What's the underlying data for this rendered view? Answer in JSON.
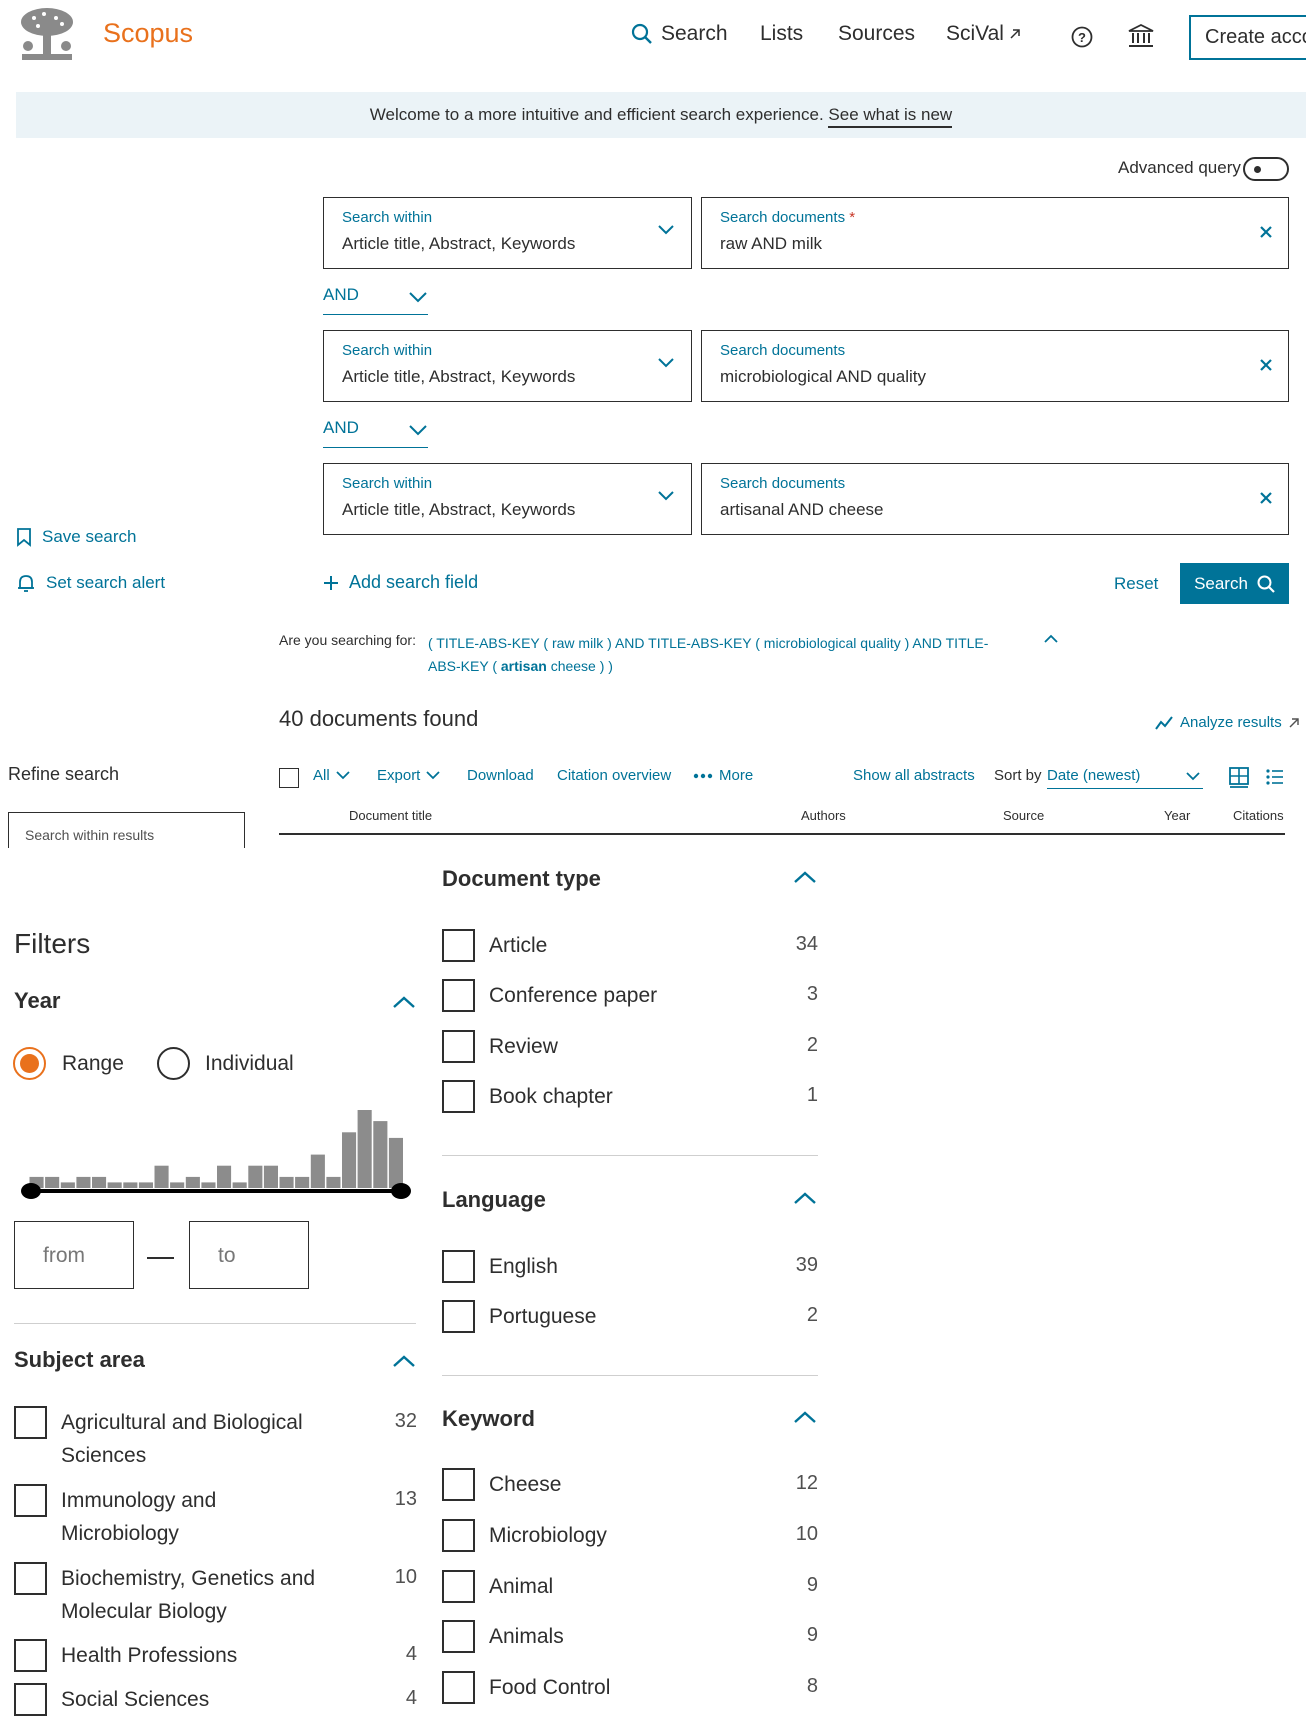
{
  "header": {
    "brand": "Scopus",
    "nav": [
      "Search",
      "Lists",
      "Sources",
      "SciVal",
      "Create acco"
    ]
  },
  "banner": {
    "text": "Welcome to a more intuitive and efficient search experience.",
    "link": "See what is new"
  },
  "advanced_query_label": "Advanced query",
  "search_rows": [
    {
      "within_label": "Search within",
      "within_value": "Article title, Abstract, Keywords",
      "doc_label": "Search documents",
      "doc_value": "raw AND milk",
      "required": "*"
    },
    {
      "within_label": "Search within",
      "within_value": "Article title, Abstract, Keywords",
      "doc_label": "Search documents",
      "doc_value": "microbiological AND quality"
    },
    {
      "within_label": "Search within",
      "within_value": "Article title, Abstract, Keywords",
      "doc_label": "Search documents",
      "doc_value": "artisanal AND cheese"
    }
  ],
  "operators": [
    "AND",
    "AND"
  ],
  "sidebar_links": {
    "save": "Save search",
    "alert": "Set search alert"
  },
  "actions": {
    "add_field": "Add search field",
    "reset": "Reset",
    "search": "Search"
  },
  "suggestion": {
    "label": "Are you searching for:",
    "part1": "( TITLE-ABS-KEY ( raw milk ) AND TITLE-ABS-KEY ( microbiological quality ) AND TITLE-ABS-KEY (",
    "bold": "artisan",
    "part2": "cheese ) )"
  },
  "results": {
    "found": "40 documents found",
    "analyze": "Analyze results"
  },
  "refine": {
    "title": "Refine search",
    "placeholder": "Search within results"
  },
  "toolbar": {
    "all": "All",
    "export": "Export",
    "download": "Download",
    "citation": "Citation overview",
    "more": "More",
    "show_abstracts": "Show all abstracts",
    "sort_by": "Sort by",
    "sort_value": "Date (newest)"
  },
  "columns": [
    "Document title",
    "Authors",
    "Source",
    "Year",
    "Citations"
  ],
  "filters": {
    "title": "Filters",
    "year": {
      "title": "Year",
      "range": "Range",
      "individual": "Individual",
      "from": "from",
      "to": "to",
      "mode": "Range"
    },
    "subject_area": {
      "title": "Subject area",
      "items": [
        {
          "label": "Agricultural and Biological Sciences",
          "count": "32"
        },
        {
          "label": "Immunology and Microbiology",
          "count": "13"
        },
        {
          "label": "Biochemistry, Genetics and Molecular Biology",
          "count": "10"
        },
        {
          "label": "Health Professions",
          "count": "4"
        },
        {
          "label": "Social Sciences",
          "count": "4"
        }
      ]
    },
    "document_type": {
      "title": "Document type",
      "items": [
        {
          "label": "Article",
          "count": "34"
        },
        {
          "label": "Conference paper",
          "count": "3"
        },
        {
          "label": "Review",
          "count": "2"
        },
        {
          "label": "Book chapter",
          "count": "1"
        }
      ]
    },
    "language": {
      "title": "Language",
      "items": [
        {
          "label": "English",
          "count": "39"
        },
        {
          "label": "Portuguese",
          "count": "2"
        }
      ]
    },
    "keyword": {
      "title": "Keyword",
      "items": [
        {
          "label": "Cheese",
          "count": "12"
        },
        {
          "label": "Microbiology",
          "count": "10"
        },
        {
          "label": "Animal",
          "count": "9"
        },
        {
          "label": "Animals",
          "count": "9"
        },
        {
          "label": "Food Control",
          "count": "8"
        }
      ]
    }
  },
  "year_histogram": [
    1,
    1,
    0.5,
    1,
    1,
    0.5,
    0.5,
    0.5,
    2,
    0.5,
    1,
    0.5,
    2,
    0.5,
    2,
    2,
    1,
    1,
    3,
    1,
    5,
    7,
    6,
    4.5
  ],
  "colors": {
    "accent": "#007398",
    "brand": "#e9711c",
    "text": "#2e2e2e"
  },
  "icons": [
    "search-icon",
    "external-link-icon",
    "help-icon",
    "institution-icon",
    "chevron-down-icon",
    "close-icon",
    "bookmark-icon",
    "bell-icon",
    "plus-icon",
    "chevron-up-icon",
    "analyze-icon",
    "more-icon",
    "grid-view-icon",
    "list-view-icon"
  ]
}
